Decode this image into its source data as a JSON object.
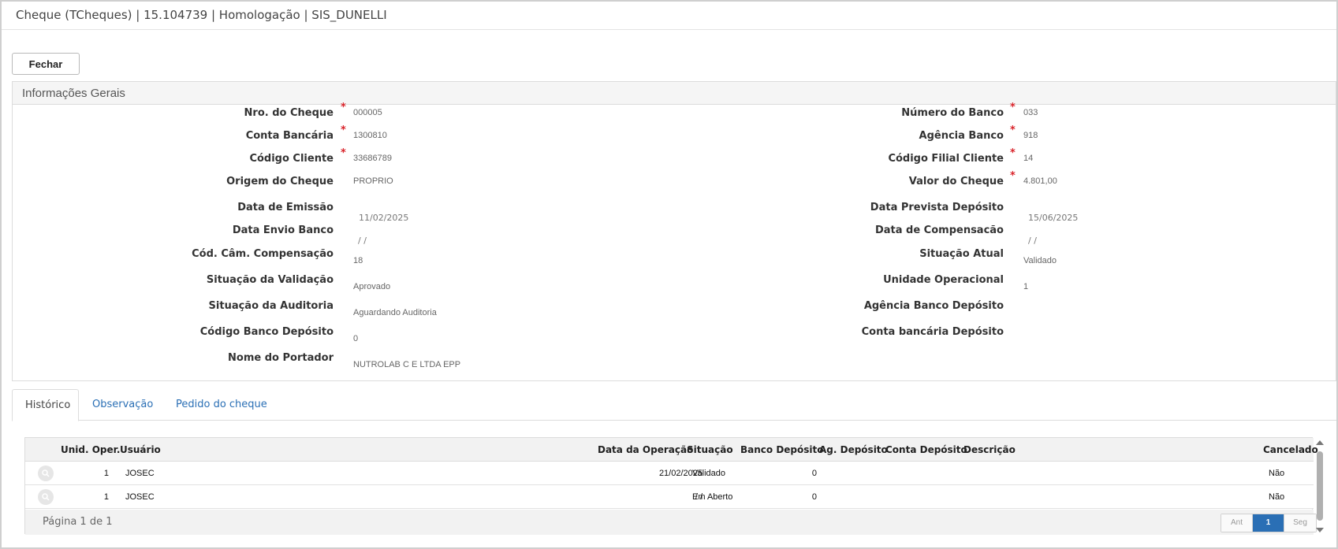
{
  "window": {
    "title": "Cheque (TCheques) | 15.104739 | Homologação | SIS_DUNELLI"
  },
  "toolbar": {
    "close_label": "Fechar"
  },
  "panel": {
    "title": "Informações Gerais",
    "left": [
      {
        "label": "Nro. do Cheque",
        "value": "000005",
        "required": "*"
      },
      {
        "label": "Conta Bancária",
        "value": "1300810",
        "required": "*"
      },
      {
        "label": "Código Cliente",
        "value": "33686789",
        "required": "*"
      },
      {
        "label": "Origem do Cheque",
        "value": "PROPRIO"
      },
      {
        "label": "Data de Emissão",
        "value": "11/02/2025"
      },
      {
        "label": "Data Envio Banco",
        "value": "/ /"
      },
      {
        "label": "Cód. Câm. Compensação",
        "value": "18"
      },
      {
        "label": "Situação da Validação",
        "value": "Aprovado"
      },
      {
        "label": "Situação da Auditoria",
        "value": "Aguardando Auditoria"
      },
      {
        "label": "Código Banco Depósito",
        "value": "0"
      },
      {
        "label": "Nome do Portador",
        "value": "NUTROLAB C E LTDA EPP"
      }
    ],
    "right": [
      {
        "label": "Número do Banco",
        "value": "033",
        "required": "*"
      },
      {
        "label": "Agência Banco",
        "value": "918",
        "required": "*"
      },
      {
        "label": "Código Filial Cliente",
        "value": "14",
        "required": "*"
      },
      {
        "label": "Valor do Cheque",
        "value": "4.801,00",
        "required": "*"
      },
      {
        "label": "Data Prevista Depósito",
        "value": "15/06/2025"
      },
      {
        "label": "Data de Compensacão",
        "value": "/ /"
      },
      {
        "label": "Situação Atual",
        "value": "Validado"
      },
      {
        "label": "Unidade Operacional",
        "value": "1"
      },
      {
        "label": "Agência Banco Depósito",
        "value": ""
      },
      {
        "label": "Conta bancária Depósito",
        "value": ""
      }
    ]
  },
  "tabs": [
    "Histórico",
    "Observação",
    "Pedido do cheque"
  ],
  "grid": {
    "columns": [
      "Unid. Oper.",
      "Usuário",
      "Data da Operação",
      "Situação",
      "Banco Depósito",
      "Ag. Depósito",
      "Conta Depósito",
      "Descrição",
      "Cancelado"
    ],
    "rows": [
      {
        "unid": "1",
        "usuario": "JOSEC",
        "data": "21/02/2025",
        "situacao": "Validado",
        "banco": "0",
        "ag": "",
        "conta": "",
        "descricao": "",
        "cancelado": "Não"
      },
      {
        "unid": "1",
        "usuario": "JOSEC",
        "data": "/ /",
        "situacao": "Em Aberto",
        "banco": "0",
        "ag": "",
        "conta": "",
        "descricao": "",
        "cancelado": "Não"
      }
    ],
    "pagination": {
      "text": "Página 1 de 1",
      "prev": "Ant",
      "current": "1",
      "next": "Seg"
    }
  }
}
